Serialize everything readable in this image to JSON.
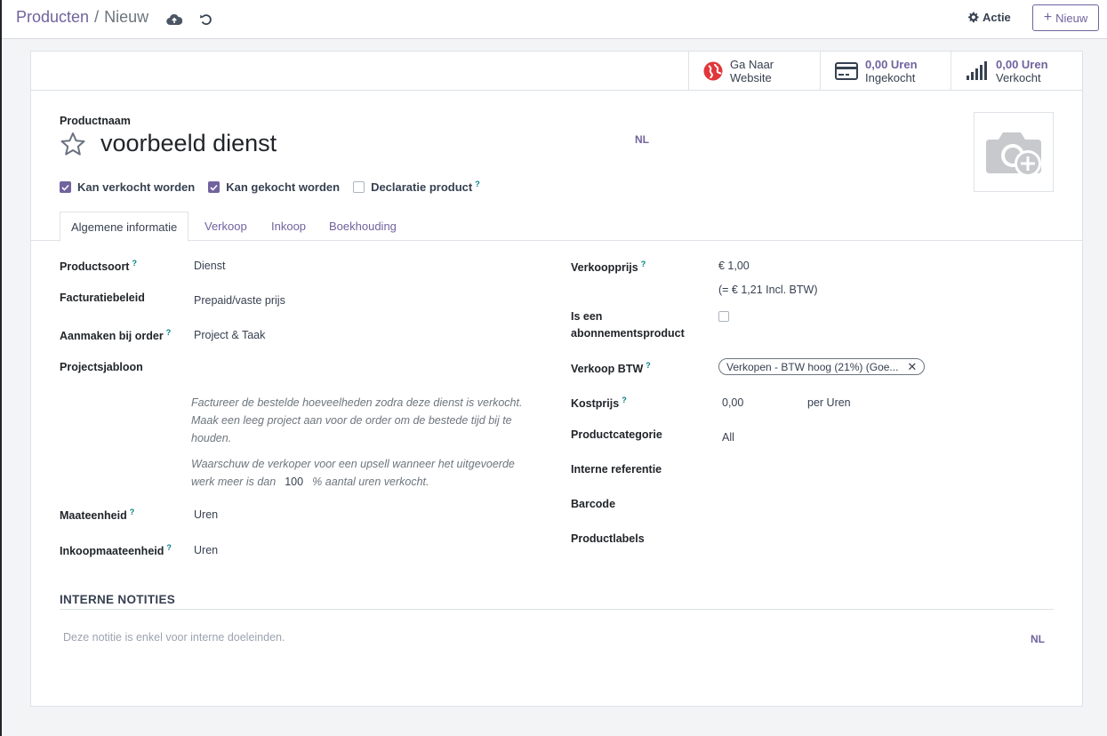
{
  "breadcrumb": {
    "parent": "Producten",
    "separator": "/",
    "current": "Nieuw"
  },
  "toolbar": {
    "action_label": "Actie",
    "new_label": "Nieuw"
  },
  "smart_buttons": [
    {
      "value": "Ga Naar",
      "label": "Website",
      "icon": "globe-icon"
    },
    {
      "value": "0,00 Uren",
      "label": "Ingekocht",
      "icon": "credit-card-icon"
    },
    {
      "value": "0,00 Uren",
      "label": "Verkocht",
      "icon": "signal-bars-icon"
    }
  ],
  "product": {
    "name_label": "Productnaam",
    "name": "voorbeeld dienst",
    "lang": "NL"
  },
  "checkboxes": [
    {
      "label": "Kan verkocht worden",
      "checked": true
    },
    {
      "label": "Kan gekocht worden",
      "checked": true
    },
    {
      "label": "Declaratie product",
      "checked": false,
      "help": "?"
    }
  ],
  "tabs": [
    "Algemene informatie",
    "Verkoop",
    "Inkoop",
    "Boekhouding"
  ],
  "left_fields": {
    "productsoort": {
      "label": "Productsoort",
      "value": "Dienst"
    },
    "facturatiebeleid": {
      "label": "Facturatiebeleid",
      "value": "Prepaid/vaste prijs"
    },
    "aanmaken": {
      "label": "Aanmaken bij order",
      "value": "Project & Taak"
    },
    "projectsjabloon": {
      "label": "Projectsjabloon",
      "value": ""
    },
    "note1": "Factureer de bestelde hoeveelheden zodra deze dienst is verkocht. Maak een leeg project aan voor de order om de bestede tijd bij te houden.",
    "note2_a": "Waarschuw de verkoper voor een upsell wanneer het uitgevoerde werk meer is dan",
    "note2_value": "100",
    "note2_b": "% aantal uren verkocht.",
    "maateenheid": {
      "label": "Maateenheid",
      "value": "Uren"
    },
    "inkoopmaateenheid": {
      "label": "Inkoopmaateenheid",
      "value": "Uren"
    }
  },
  "right_fields": {
    "verkoopprijs": {
      "label": "Verkoopprijs",
      "value": "€ 1,00",
      "incl": "(= € 1,21 Incl. BTW)"
    },
    "abonnement": {
      "label_1": "Is een",
      "label_2": "abonnementsproduct",
      "checked": false
    },
    "verkoop_btw": {
      "label": "Verkoop BTW",
      "tag": "Verkopen - BTW hoog (21%) (Goe..."
    },
    "kostprijs": {
      "label": "Kostprijs",
      "value": "0,00",
      "unit": "per Uren"
    },
    "productcategorie": {
      "label": "Productcategorie",
      "value": "All"
    },
    "interne_referentie": {
      "label": "Interne referentie"
    },
    "barcode": {
      "label": "Barcode"
    },
    "productlabels": {
      "label": "Productlabels"
    }
  },
  "notes": {
    "title": "INTERNE NOTITIES",
    "placeholder": "Deze notitie is enkel voor interne doeleinden.",
    "lang": "NL"
  },
  "colors": {
    "accent": "#71639e",
    "help": "#017e84",
    "globe": "#e2363a"
  }
}
